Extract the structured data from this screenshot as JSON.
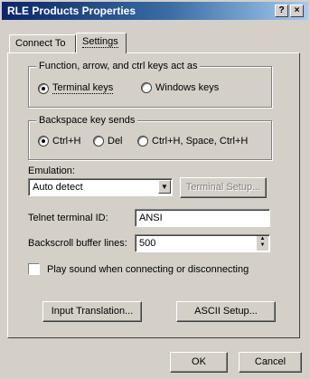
{
  "window": {
    "title": "RLE Products Properties",
    "help_glyph": "?",
    "close_glyph": "×"
  },
  "tabs": [
    {
      "label": "Connect To",
      "active": false
    },
    {
      "label": "Settings",
      "active": true
    }
  ],
  "function_keys": {
    "legend": "Function, arrow, and ctrl keys act as",
    "options": [
      {
        "label": "Terminal keys",
        "selected": true
      },
      {
        "label": "Windows keys",
        "selected": false
      }
    ]
  },
  "backspace": {
    "legend": "Backspace key sends",
    "options": [
      {
        "label": "Ctrl+H",
        "selected": true
      },
      {
        "label": "Del",
        "selected": false
      },
      {
        "label": "Ctrl+H, Space, Ctrl+H",
        "selected": false
      }
    ]
  },
  "emulation": {
    "label": "Emulation:",
    "value": "Auto detect",
    "setup_button": "Terminal Setup..."
  },
  "telnet": {
    "label": "Telnet terminal ID:",
    "value": "ANSI"
  },
  "backscroll": {
    "label": "Backscroll buffer lines:",
    "value": "500"
  },
  "play_sound": {
    "label": "Play sound when connecting or disconnecting",
    "checked": false
  },
  "buttons": {
    "input_translation": "Input Translation...",
    "ascii_setup": "ASCII Setup...",
    "ok": "OK",
    "cancel": "Cancel"
  }
}
